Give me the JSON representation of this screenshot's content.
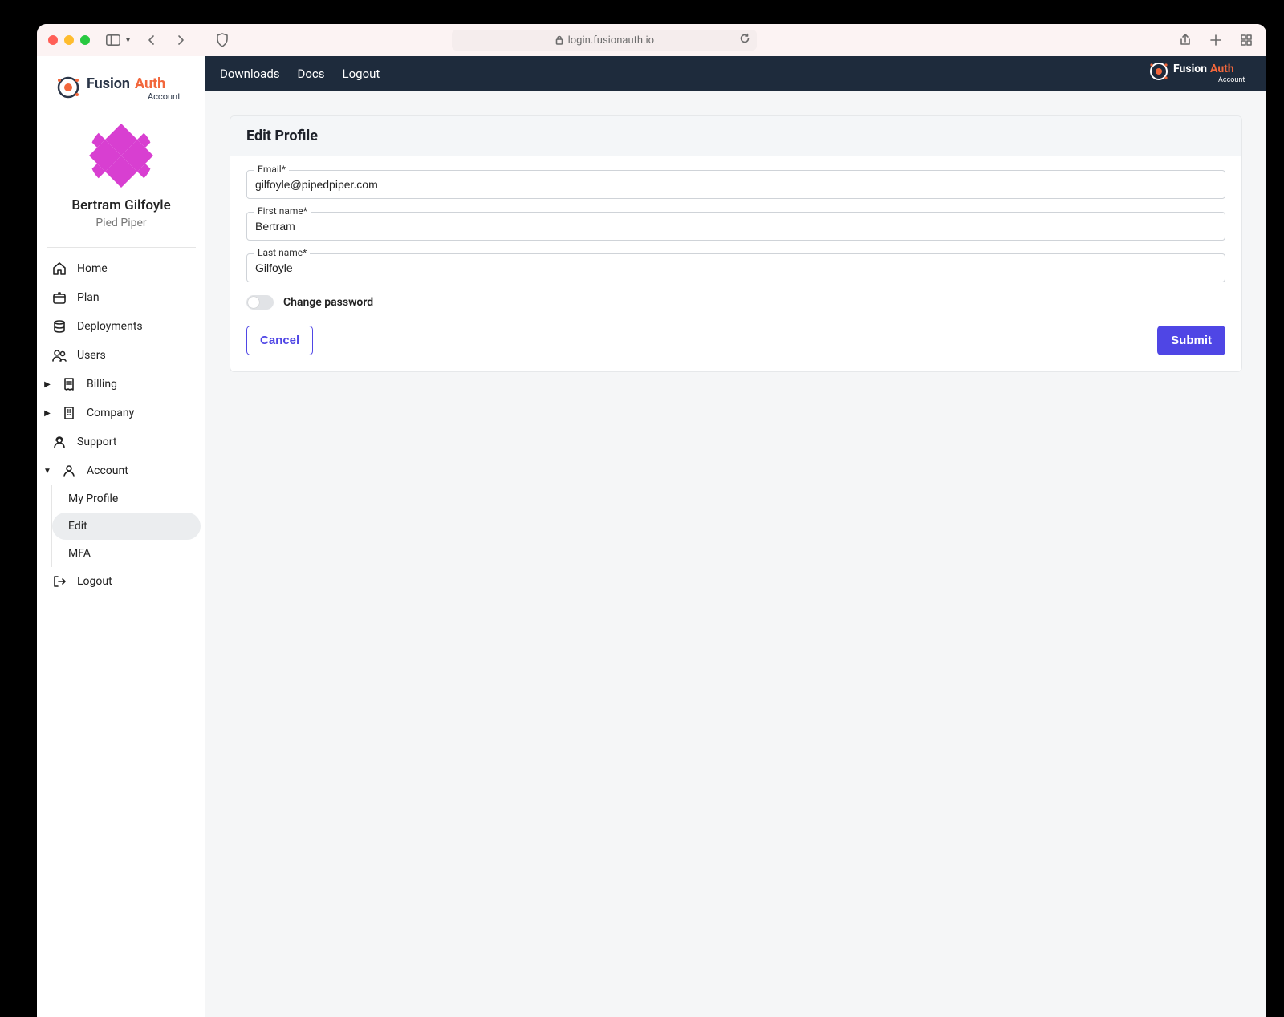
{
  "browser": {
    "url": "login.fusionauth.io"
  },
  "brand": {
    "name": "FusionAuth",
    "subtitle": "Account"
  },
  "sidebar": {
    "user_name": "Bertram Gilfoyle",
    "user_company": "Pied Piper",
    "items": [
      {
        "label": "Home"
      },
      {
        "label": "Plan"
      },
      {
        "label": "Deployments"
      },
      {
        "label": "Users"
      },
      {
        "label": "Billing"
      },
      {
        "label": "Company"
      },
      {
        "label": "Support"
      },
      {
        "label": "Account"
      }
    ],
    "account_sub": [
      {
        "label": "My Profile"
      },
      {
        "label": "Edit"
      },
      {
        "label": "MFA"
      }
    ],
    "logout": "Logout"
  },
  "topbar": {
    "downloads": "Downloads",
    "docs": "Docs",
    "logout": "Logout"
  },
  "panel": {
    "title": "Edit Profile",
    "email_label": "Email*",
    "email_value": "gilfoyle@pipedpiper.com",
    "first_name_label": "First name*",
    "first_name_value": "Bertram",
    "last_name_label": "Last name*",
    "last_name_value": "Gilfoyle",
    "change_password": "Change password",
    "cancel": "Cancel",
    "submit": "Submit"
  }
}
